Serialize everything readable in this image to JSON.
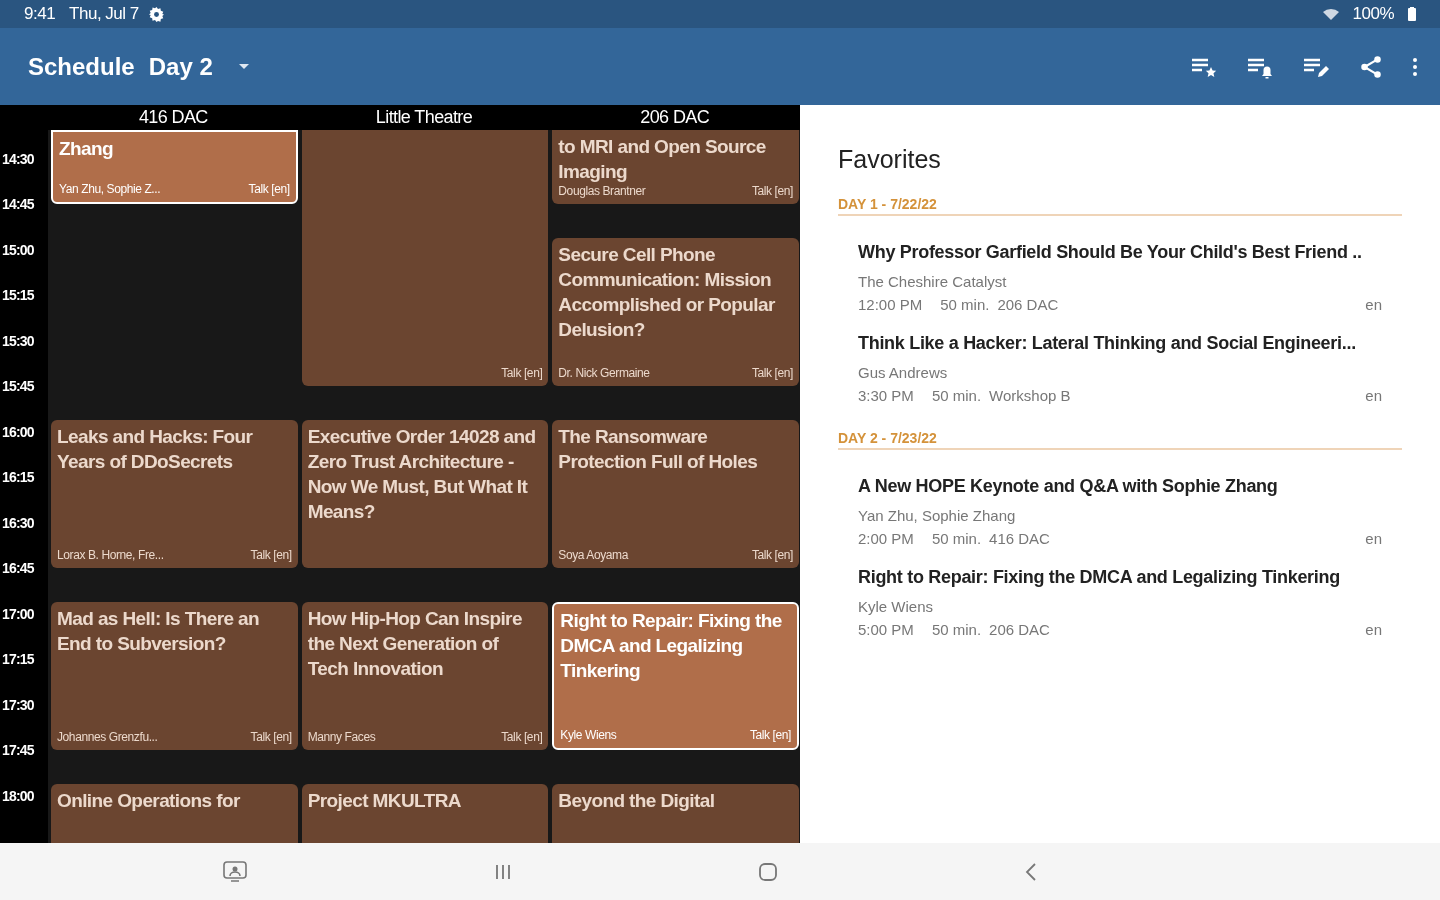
{
  "status_bar": {
    "time": "9:41",
    "date": "Thu, Jul 7",
    "battery": "100%"
  },
  "app_bar": {
    "title": "Schedule",
    "day": "Day 2"
  },
  "schedule": {
    "rooms": [
      "416 DAC",
      "Little Theatre",
      "206 DAC"
    ],
    "times": [
      "14:30",
      "14:45",
      "15:00",
      "15:15",
      "15:30",
      "15:45",
      "16:00",
      "16:15",
      "16:30",
      "16:45",
      "17:00",
      "17:15",
      "17:30",
      "17:45",
      "18:00"
    ],
    "columns": [
      [
        {
          "title": "Zhang",
          "speakers": "Yan Zhu, Sophie Z...",
          "type": "Talk [en]",
          "favorite": true
        },
        {
          "title": "Leaks and Hacks: Four Years of DDoSecrets",
          "speakers": "Lorax B. Horne, Fre...",
          "type": "Talk [en]",
          "favorite": false
        },
        {
          "title": "Mad as Hell: Is There an End to Subversion?",
          "speakers": "Johannes Grenzfu...",
          "type": "Talk [en]",
          "favorite": false
        },
        {
          "title": "Online Operations for",
          "favorite": false
        }
      ],
      [
        {
          "type": "Talk [en]",
          "favorite": false
        },
        {
          "title": "Executive Order 14028 and Zero Trust Architecture - Now We Must, But What It Means?",
          "favorite": false
        },
        {
          "title": "How Hip-Hop Can Inspire the Next Generation of Tech Innovation",
          "speakers": "Manny Faces",
          "type": "Talk [en]",
          "favorite": false
        },
        {
          "title": "Project MKULTRA",
          "favorite": false
        }
      ],
      [
        {
          "title": "to MRI and Open Source Imaging",
          "speakers": "Douglas Brantner",
          "type": "Talk [en]",
          "favorite": false
        },
        {
          "title": "Secure Cell Phone Communication: Mission Accomplished or Popular Delusion?",
          "speakers": "Dr. Nick Germaine",
          "type": "Talk [en]",
          "favorite": false
        },
        {
          "title": "The Ransomware Protection Full of Holes",
          "speakers": "Soya Aoyama",
          "type": "Talk [en]",
          "favorite": false
        },
        {
          "title": "Right to Repair: Fixing the DMCA and Legalizing Tinkering",
          "speakers": "Kyle Wiens",
          "type": "Talk [en]",
          "favorite": true
        },
        {
          "title": "Beyond the Digital",
          "favorite": false
        }
      ]
    ]
  },
  "favorites": {
    "title": "Favorites",
    "days": [
      {
        "label": "DAY 1 - 7/22/22",
        "items": [
          {
            "title": "Why Professor Garfield Should Be Your Child's Best Friend ..",
            "speakers": "The Cheshire Catalyst",
            "time": "12:00 PM",
            "duration": "50 min.",
            "room": "206 DAC",
            "language": "en"
          },
          {
            "title": "Think Like a Hacker: Lateral Thinking and Social Engineeri...",
            "speakers": "Gus Andrews",
            "time": "3:30 PM",
            "duration": "50 min.",
            "room": "Workshop B",
            "language": "en"
          }
        ]
      },
      {
        "label": "DAY 2 - 7/23/22",
        "items": [
          {
            "title": "A New HOPE Keynote and Q&A with Sophie Zhang",
            "speakers": "Yan Zhu, Sophie Zhang",
            "time": "2:00 PM",
            "duration": "50 min.",
            "room": "416 DAC",
            "language": "en"
          },
          {
            "title": "Right to Repair: Fixing the DMCA and Legalizing Tinkering",
            "speakers": "Kyle Wiens",
            "time": "5:00 PM",
            "duration": "50 min.",
            "room": "206 DAC",
            "language": "en"
          }
        ]
      }
    ]
  }
}
